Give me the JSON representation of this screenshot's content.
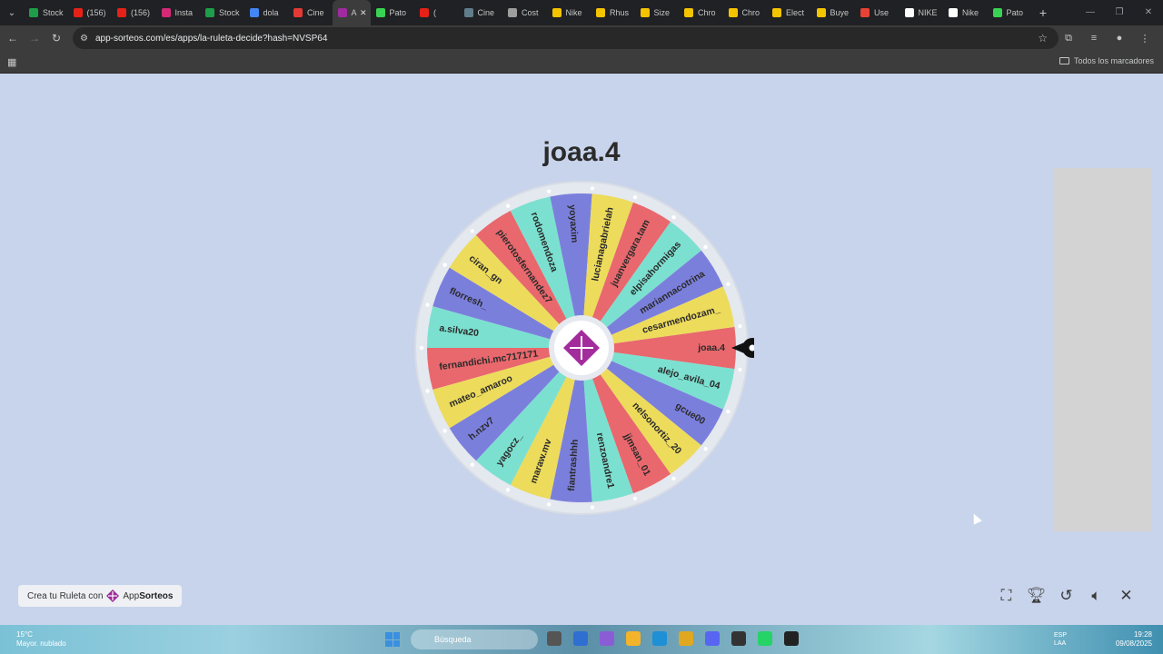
{
  "browser": {
    "tabs": [
      {
        "label": "Stock",
        "color": "#1e9e4a"
      },
      {
        "label": "(156)",
        "color": "#e62117"
      },
      {
        "label": "(156)",
        "color": "#e62117"
      },
      {
        "label": "Insta",
        "color": "#d62976"
      },
      {
        "label": "Stock",
        "color": "#1e9e4a"
      },
      {
        "label": "dola",
        "color": "#4285f4"
      },
      {
        "label": "Cine",
        "color": "#e53935"
      },
      {
        "label": "A",
        "color": "#a02aa0",
        "active": true
      },
      {
        "label": "Pato",
        "color": "#39d353"
      },
      {
        "label": "(",
        "color": "#e62117"
      },
      {
        "label": "Cine",
        "color": "#607d8b"
      },
      {
        "label": "Cost",
        "color": "#9e9e9e"
      },
      {
        "label": "Nike",
        "color": "#f5c400"
      },
      {
        "label": "Rhus",
        "color": "#f5c400"
      },
      {
        "label": "Size",
        "color": "#f5c400"
      },
      {
        "label": "Chro",
        "color": "#f5c400"
      },
      {
        "label": "Chro",
        "color": "#f5c400"
      },
      {
        "label": "Elect",
        "color": "#f5c400"
      },
      {
        "label": "Buye",
        "color": "#f5c400"
      },
      {
        "label": "Use",
        "color": "#ea4335"
      },
      {
        "label": "NIKE",
        "color": "#ffffff"
      },
      {
        "label": "Nike",
        "color": "#ffffff"
      },
      {
        "label": "Pato",
        "color": "#39d353"
      }
    ],
    "url": "app-sorteos.com/es/apps/la-ruleta-decide?hash=NVSP64",
    "bookmarks_label": "Todos los marcadores"
  },
  "page": {
    "winner": "joaa.4",
    "credit_prefix": "Crea tu Ruleta con",
    "credit_brand_a": "App",
    "credit_brand_b": "Sorteos"
  },
  "wheel": {
    "colors": [
      "#7b7fdc",
      "#eddb5c",
      "#e8686d",
      "#7ce0d0"
    ],
    "names": [
      "joaa.4",
      "alejo_avila_04",
      "gcue00",
      "nelsonortiz_20",
      "jjmsan_01",
      "renzoandre1",
      "fiantrashhh",
      "maraw.mv",
      "yagocz_",
      "h.nzv7",
      "mateo_amaroo",
      "fernandichi.mc717171",
      "a.silva20",
      "florresh_",
      "ciran_gn",
      "pierotosfernandez7",
      "rodomendoza",
      "yoyaxim",
      "lucianagabrielah",
      "juanvergara.tam",
      "elpisahormigas",
      "mariannacotrina",
      "cesarmendozam_"
    ],
    "slice_colors": [
      "#e8686d",
      "#7ce0d0",
      "#7b7fdc",
      "#eddb5c",
      "#e8686d",
      "#7ce0d0",
      "#7b7fdc",
      "#eddb5c",
      "#7ce0d0",
      "#7b7fdc",
      "#eddb5c",
      "#e8686d",
      "#7ce0d0",
      "#7b7fdc",
      "#eddb5c",
      "#e8686d",
      "#7ce0d0",
      "#7b7fdc",
      "#eddb5c",
      "#e8686d",
      "#7ce0d0",
      "#7b7fdc",
      "#eddb5c"
    ]
  },
  "taskbar": {
    "weather_temp": "15°C",
    "weather_text": "Mayor. nublado",
    "search_placeholder": "Búsqueda",
    "lang_top": "ESP",
    "lang_bottom": "LAA",
    "time": "19:28",
    "date": "09/08/2025"
  }
}
